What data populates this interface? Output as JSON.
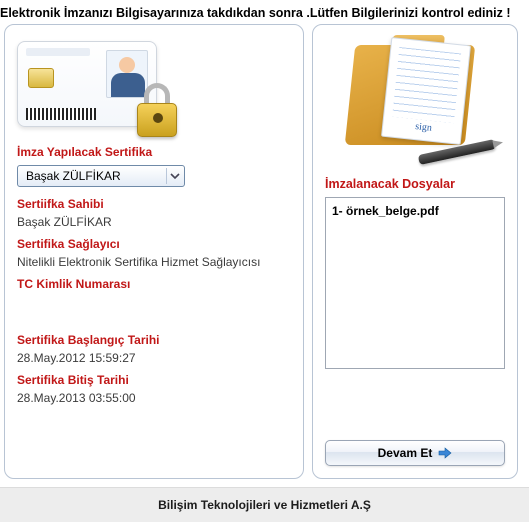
{
  "instruction": "Elektronik İmzanızı Bilgisayarınıza takdıkdan sonra .Lütfen Bilgilerinizi kontrol ediniz !",
  "left": {
    "cert_select_label": "İmza Yapılacak Sertifika",
    "cert_selected": "Başak ZÜLFİKAR",
    "owner_label": "Sertiifka Sahibi",
    "owner_value": "Başak ZÜLFİKAR",
    "provider_label": "Sertifika Sağlayıcı",
    "provider_value": "Nitelikli Elektronik Sertifika Hizmet Sağlayıcısı",
    "tckn_label": "TC Kimlik Numarası",
    "tckn_value": "",
    "start_label": "Sertifika Başlangıç Tarihi",
    "start_value": "28.May.2012 15:59:27",
    "end_label": "Sertifika Bitiş Tarihi",
    "end_value": "28.May.2013 03:55:00"
  },
  "right": {
    "files_title": "İmzalanacak Dosyalar",
    "files": [
      "1- örnek_belge.pdf"
    ],
    "continue_label": "Devam Et"
  },
  "footer": "Bilişim Teknolojileri ve Hizmetleri A.Ş"
}
